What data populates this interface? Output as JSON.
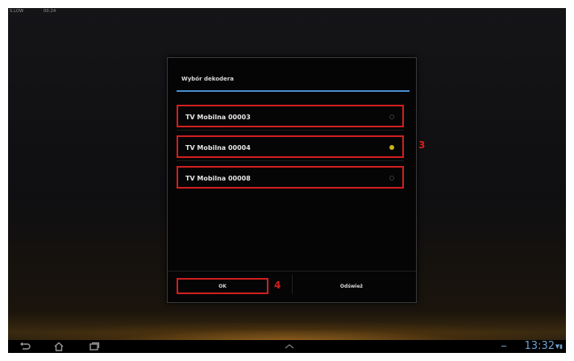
{
  "status_bar": {
    "left_text_1": "S.LOW",
    "left_text_2": "00:24"
  },
  "dialog": {
    "title": "Wybór dekodera",
    "options": [
      {
        "label": "TV Mobilna 00003",
        "selected": false
      },
      {
        "label": "TV Mobilna 00004",
        "selected": true
      },
      {
        "label": "TV Mobilna 00008",
        "selected": false
      }
    ],
    "ok_label": "OK",
    "cancel_label": "Odśwież"
  },
  "markers": {
    "options_marker": "3",
    "ok_marker": "4"
  },
  "nav_bar": {
    "time": "13:32"
  },
  "colors": {
    "accent_line": "#4a8fd0",
    "highlight": "#d21f1f",
    "radio_on": "#c9b21a",
    "clock": "#6ea0d0"
  }
}
